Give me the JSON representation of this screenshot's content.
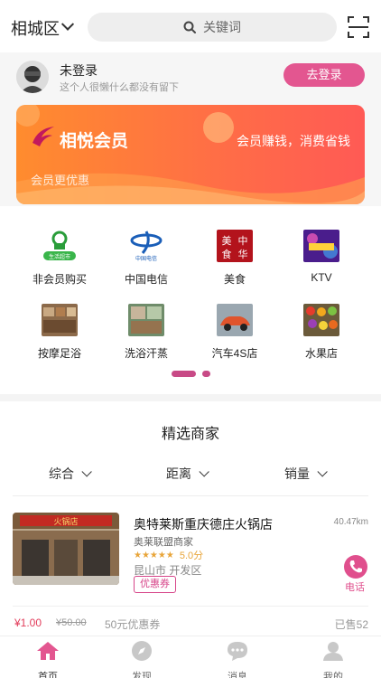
{
  "header": {
    "city": "相城区",
    "search_placeholder": "关键词"
  },
  "profile": {
    "name": "未登录",
    "signature": "这个人很懒什么都没有留下",
    "login_label": "去登录"
  },
  "banner": {
    "brand": "相悦会员",
    "slogan": "会员赚钱，消费省钱",
    "subtitle": "会员更优惠"
  },
  "categories": [
    {
      "label": "非会员购买",
      "icon": "supermarket-icon"
    },
    {
      "label": "中国电信",
      "icon": "china-telecom-icon"
    },
    {
      "label": "美食",
      "icon": "food-icon"
    },
    {
      "label": "KTV",
      "icon": "ktv-icon"
    },
    {
      "label": "按摩足浴",
      "icon": "massage-icon"
    },
    {
      "label": "洗浴汗蒸",
      "icon": "bath-icon"
    },
    {
      "label": "汽车4S店",
      "icon": "car-icon"
    },
    {
      "label": "水果店",
      "icon": "fruit-icon"
    }
  ],
  "section": {
    "title": "精选商家",
    "sorts": [
      "综合",
      "距离",
      "销量"
    ]
  },
  "merchant": {
    "name": "奥特莱斯重庆德庄火锅店",
    "distance": "40.47km",
    "tag": "奥莱联盟商家",
    "stars": "★★★★★",
    "score": "5.0分",
    "area": "昆山市 开发区",
    "coupon": "优惠券",
    "call_label": "电话",
    "price": "¥1.00",
    "old_price": "¥50.00",
    "coupon_text": "50元优惠券",
    "sold": "已售52"
  },
  "tabs": [
    {
      "label": "首页",
      "icon": "home-icon",
      "active": true
    },
    {
      "label": "发现",
      "icon": "compass-icon",
      "active": false
    },
    {
      "label": "消息",
      "icon": "message-icon",
      "active": false
    },
    {
      "label": "我的",
      "icon": "user-icon",
      "active": false
    }
  ],
  "colors": {
    "accent": "#e35690",
    "banner_start": "#ff8c2e",
    "banner_end": "#ff5a55",
    "price": "#e23b5a"
  }
}
